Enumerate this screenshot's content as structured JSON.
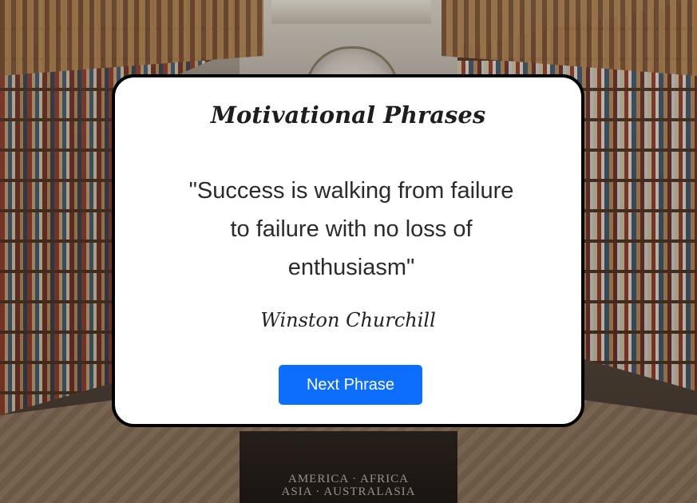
{
  "app": {
    "title": "Motivational Phrases"
  },
  "quote": {
    "text": "\"Success is walking from failure to failure with no loss of enthusiasm\"",
    "author": "Winston Churchill"
  },
  "actions": {
    "next_label": "Next Phrase"
  },
  "background": {
    "sign_line1": "AMERICA · AFRICA",
    "sign_line2": "ASIA · AUSTRALASIA"
  },
  "colors": {
    "button": "#0d6efd",
    "card": "#ffffff",
    "card_border": "#000000"
  }
}
